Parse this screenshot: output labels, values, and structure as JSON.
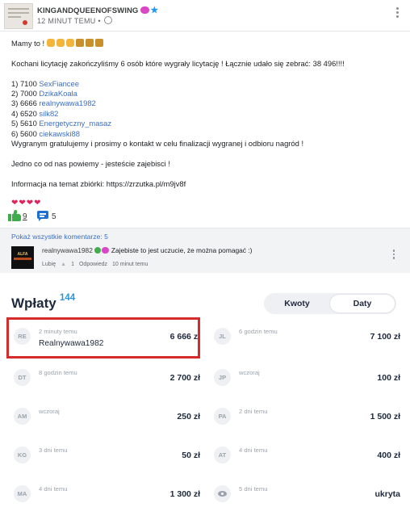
{
  "post": {
    "author": "KINGANDQUEENOFSWING",
    "time": "12 MINUT TEMU •",
    "greeting": "Mamy to !",
    "intro": "Kochani licytację zakończyliśmy 6 osób które wygrały licytację ! Łącznie udało się zebrać: 38 496!!!!",
    "winners": [
      {
        "rank": "1) 7100",
        "user": "SexFiancee"
      },
      {
        "rank": "2) 7000",
        "user": "DzikaKoala"
      },
      {
        "rank": "3) 6666",
        "user": "realnywawa1982"
      },
      {
        "rank": "4) 6520",
        "user": "silk82"
      },
      {
        "rank": "5) 5610",
        "user": "Energetyczny_masaz"
      },
      {
        "rank": "6) 5600",
        "user": "ciekawski88"
      }
    ],
    "thanks": "Wygranym gratulujemy i prosimy o kontakt w celu finalizacji wygranej i odbioru nagród !",
    "outro": "Jedno co od nas powiemy - jesteście zajebisci !",
    "info": "Informacja na temat zbiórki: https://zrzutka.pl/m9jv8f",
    "hearts": "❤❤❤❤",
    "likes": "9",
    "comments_count": "5"
  },
  "comments": {
    "show_all": "Pokaż wszystkie komentarze: 5",
    "avatar_text": "ALFA",
    "user": "realnywawa1982",
    "text": "Zajebiste to jest uczucie, że można pomagać :)",
    "like": "Lubię",
    "like_count": "1",
    "reply": "Odpowiedz",
    "time": "10 minut temu"
  },
  "wplaty": {
    "title": "Wpłaty",
    "count": "144",
    "toggle": {
      "kwoty": "Kwoty",
      "daty": "Daty"
    },
    "left": [
      {
        "initials": "RE",
        "when": "2 minuty temu",
        "name": "Realnywawa1982",
        "amount": "6 666 zł"
      },
      {
        "initials": "DT",
        "when": "8 godzin temu",
        "name": "",
        "amount": "2 700 zł"
      },
      {
        "initials": "AM",
        "when": "wczoraj",
        "name": "",
        "amount": "250 zł"
      },
      {
        "initials": "KG",
        "when": "3 dni temu",
        "name": "",
        "amount": "50 zł"
      },
      {
        "initials": "MA",
        "when": "4 dni temu",
        "name": "",
        "amount": "1 300 zł"
      }
    ],
    "right": [
      {
        "initials": "JL",
        "when": "6 godzin temu",
        "name": "",
        "amount": "7 100 zł"
      },
      {
        "initials": "JP",
        "when": "wczoraj",
        "name": "",
        "amount": "100 zł"
      },
      {
        "initials": "PA",
        "when": "2 dni temu",
        "name": "",
        "amount": "1 500 zł"
      },
      {
        "initials": "AT",
        "when": "4 dni temu",
        "name": "",
        "amount": "400 zł"
      },
      {
        "initials": "",
        "when": "5 dni temu",
        "name": "",
        "amount": "ukryta"
      }
    ]
  }
}
